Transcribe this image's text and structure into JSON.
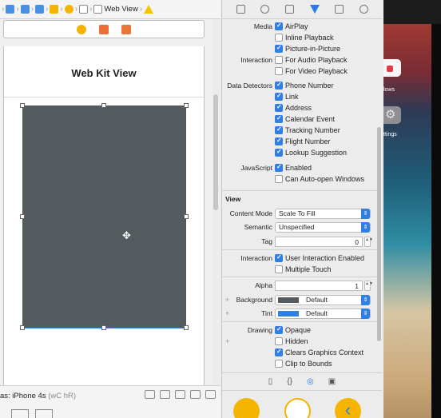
{
  "jumpbar": {
    "title": "Web View",
    "items": [
      "project-icon",
      "folder-icon",
      "folder-icon",
      "folder-icon",
      "storyboard-icon",
      "scene-icon",
      "viewcontroller-icon",
      "view-icon",
      "webview-icon"
    ]
  },
  "scene_dock": {
    "icons": [
      "viewcontroller-icon",
      "first-responder-icon",
      "exit-icon"
    ],
    "colors": [
      "#f5b400",
      "#e87038",
      "#e8753a"
    ]
  },
  "view_controller": {
    "title": "Web Kit View",
    "webview_color": "#545b5f"
  },
  "bottombar": {
    "device": "as: iPhone 4s",
    "traits": "(wC hR)"
  },
  "inspector": {
    "tabs": [
      "file-icon",
      "help-icon",
      "identity-icon",
      "attributes-icon",
      "size-icon",
      "connections-icon"
    ],
    "media": {
      "label": "Media",
      "airplay": "AirPlay",
      "inline": "Inline Playback",
      "pip": "Picture-in-Picture"
    },
    "interaction": {
      "label": "Interaction",
      "audio": "For Audio Playback",
      "video": "For Video Playback"
    },
    "detectors": {
      "label": "Data Detectors",
      "items": [
        "Phone Number",
        "Link",
        "Address",
        "Calendar Event",
        "Tracking Number",
        "Flight Number",
        "Lookup Suggestion"
      ]
    },
    "javascript": {
      "label": "JavaScript",
      "enabled": "Enabled",
      "windows": "Can Auto-open Windows"
    },
    "view": {
      "header": "View",
      "content_mode_label": "Content Mode",
      "content_mode": "Scale To Fill",
      "semantic_label": "Semantic",
      "semantic": "Unspecified",
      "tag_label": "Tag",
      "tag": "0",
      "interaction_label": "Interaction",
      "user_interaction": "User Interaction Enabled",
      "multiple_touch": "Multiple Touch",
      "alpha_label": "Alpha",
      "alpha": "1",
      "background_label": "Background",
      "background": "Default",
      "background_color": "#545b5f",
      "tint_label": "Tint",
      "tint": "Default",
      "tint_color": "#2f7fe6",
      "drawing_label": "Drawing",
      "opaque": "Opaque",
      "hidden": "Hidden",
      "clears": "Clears Graphics Context",
      "clip": "Clip to Bounds"
    }
  },
  "library": {
    "tabs": [
      "file-template-icon",
      "code-snippet-icon",
      "object-library-icon",
      "media-library-icon"
    ],
    "item_colors": [
      "#f5b400",
      "#ffffff",
      "#f5b400"
    ]
  },
  "simulator": {
    "app1_label": "lows",
    "app2_label": "ttings"
  }
}
